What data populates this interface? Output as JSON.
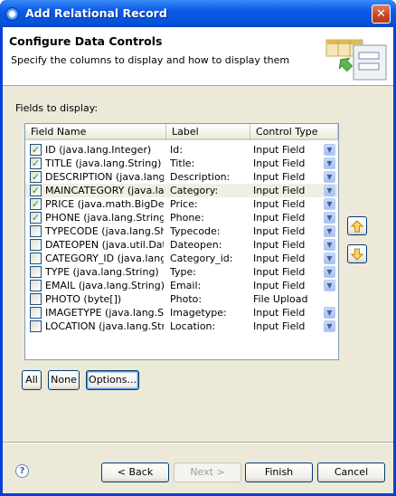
{
  "window": {
    "title": "Add Relational Record",
    "close_glyph": "✕"
  },
  "header": {
    "title": "Configure Data Controls",
    "description": "Specify the columns to display and how to display them"
  },
  "fields_label": "Fields to display:",
  "table": {
    "columns": [
      "Field Name",
      "Label",
      "Control Type"
    ],
    "rows": [
      {
        "checked": true,
        "field": "ID (java.lang.Integer)",
        "label": "Id:",
        "control": "Input Field"
      },
      {
        "checked": true,
        "field": "TITLE (java.lang.String)",
        "label": "Title:",
        "control": "Input Field"
      },
      {
        "checked": true,
        "field": "DESCRIPTION (java.lang.S",
        "label": "Description:",
        "control": "Input Field"
      },
      {
        "checked": true,
        "field": "MAINCATEGORY (java.lan",
        "label": "Category:",
        "control": "Input Field"
      },
      {
        "checked": true,
        "field": "PRICE (java.math.BigDeci",
        "label": "Price:",
        "control": "Input Field"
      },
      {
        "checked": true,
        "field": "PHONE (java.lang.String)",
        "label": "Phone:",
        "control": "Input Field"
      },
      {
        "checked": false,
        "field": "TYPECODE (java.lang.Shor",
        "label": "Typecode:",
        "control": "Input Field"
      },
      {
        "checked": false,
        "field": "DATEOPEN (java.util.Date)",
        "label": "Dateopen:",
        "control": "Input Field"
      },
      {
        "checked": false,
        "field": "CATEGORY_ID (java.lang.",
        "label": "Category_id:",
        "control": "Input Field"
      },
      {
        "checked": false,
        "field": "TYPE (java.lang.String)",
        "label": "Type:",
        "control": "Input Field"
      },
      {
        "checked": false,
        "field": "EMAIL (java.lang.String)",
        "label": "Email:",
        "control": "Input Field"
      },
      {
        "checked": false,
        "field": "PHOTO (byte[])",
        "label": "Photo:",
        "control": "File Upload"
      },
      {
        "checked": false,
        "field": "IMAGETYPE (java.lang.Stri",
        "label": "Imagetype:",
        "control": "Input Field"
      },
      {
        "checked": false,
        "field": "LOCATION (java.lang.Strin",
        "label": "Location:",
        "control": "Input Field"
      }
    ]
  },
  "side_buttons": {
    "up_icon": "arrow-up-icon",
    "down_icon": "arrow-down-icon"
  },
  "select_buttons": {
    "all": "All",
    "none": "None",
    "options": "Options..."
  },
  "footer": {
    "help_glyph": "?",
    "back": "< Back",
    "next": "Next >",
    "finish": "Finish",
    "cancel": "Cancel"
  },
  "colors": {
    "title_bar": "#0a5ae8",
    "dialog_bg": "#ece9d8",
    "check": "#21a121"
  }
}
